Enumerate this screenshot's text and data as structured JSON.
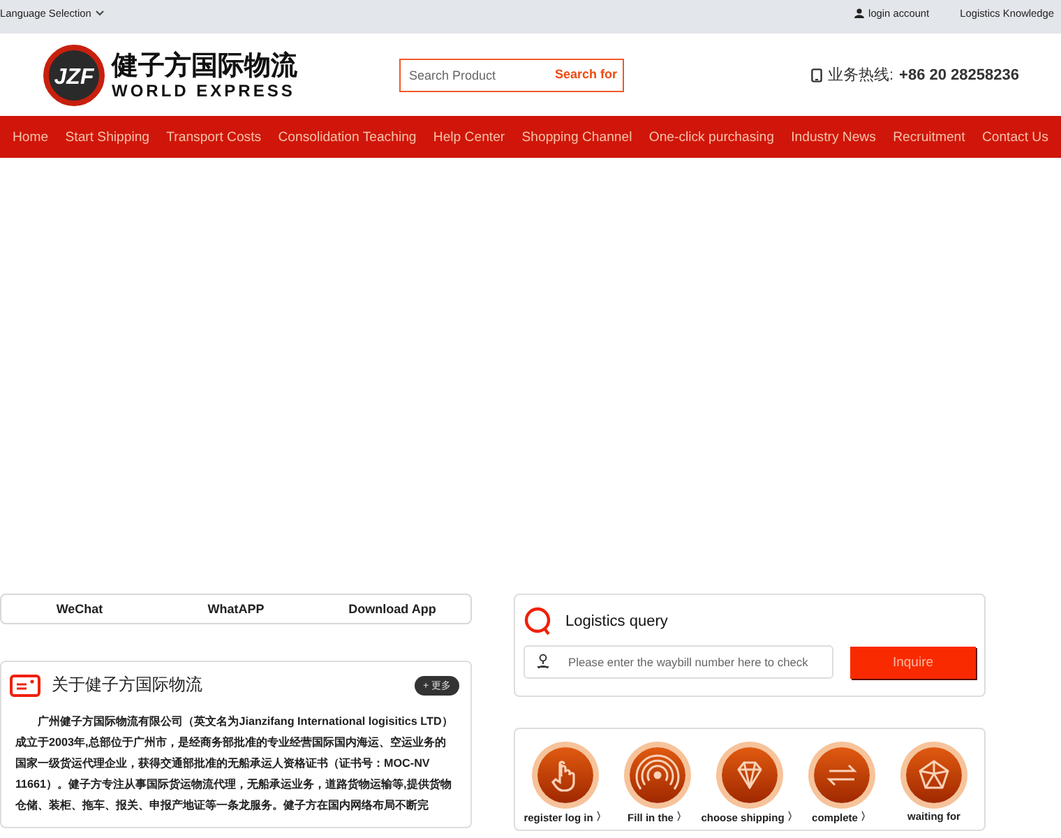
{
  "top_bar": {
    "language": "Language Selection",
    "links": [
      "login account",
      "Logistics Knowledge"
    ]
  },
  "header": {
    "logo": {
      "mark": "JZF",
      "name_cn": "健子方国际物流",
      "name_en": "WORLD EXPRESS"
    },
    "search": {
      "placeholder": "Search Product",
      "button": "Search for"
    },
    "hotline": {
      "label": "业务热线:",
      "number": "+86 20 28258236"
    }
  },
  "nav": [
    "Home",
    "Start Shipping",
    "Transport Costs",
    "Consolidation Teaching",
    "Help Center",
    "Shopping Channel",
    "One-click purchasing",
    "Industry News",
    "Recruitment",
    "Contact Us"
  ],
  "social_tabs": [
    "WeChat",
    "WhatAPP",
    "Download App"
  ],
  "about": {
    "title": "关于健子方国际物流",
    "more": "+ 更多",
    "text": "广州健子方国际物流有限公司（英文名为Jianzifang International logisitics LTD）成立于2003年,总部位于广州市，是经商务部批准的专业经营国际国内海运、空运业务的国家一级货运代理企业，获得交通部批准的无船承运人资格证书（证书号：MOC-NV 11661）。健子方专注从事国际货运物流代理，无船承运业务，道路货物运输等,提供货物仓储、装柜、拖车、报关、申报产地证等一条龙服务。健子方在国内网络布局不断完"
  },
  "logistics_query": {
    "title": "Logistics query",
    "placeholder": "Please enter the waybill number here to check",
    "button": "Inquire"
  },
  "steps": [
    {
      "kind": "hand",
      "label": "register log in"
    },
    {
      "kind": "signal",
      "label": "Fill in the"
    },
    {
      "kind": "diamond",
      "label": "choose shipping"
    },
    {
      "kind": "exchange",
      "label": "complete"
    },
    {
      "kind": "pentagon",
      "label": "waiting for"
    }
  ],
  "step_separator": "〉"
}
